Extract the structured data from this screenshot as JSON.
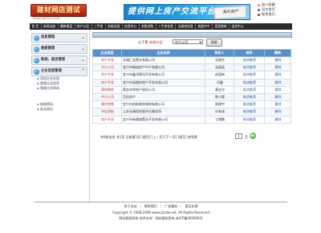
{
  "header": {
    "logo_text": "建材网店测试",
    "logo_url": "www.jiancai.com",
    "banner_text": "提供网上房产交流平台",
    "banner_sign": "海外房产",
    "top_links": [
      "加入收藏",
      "设为首页",
      "联系我们"
    ]
  },
  "nav": {
    "items": [
      "首 页",
      "新闻动态",
      "最新楼盘",
      "房产公告",
      "二手房",
      "房屋出租",
      "信息中心",
      "求租求购",
      "二手房信息",
      "出租房信息",
      "房屋中介",
      "家居装修",
      "会员中心"
    ]
  },
  "sidebar": {
    "blocks": [
      {
        "label": "信息管理"
      },
      {
        "label": "楼盘管理"
      },
      {
        "label": "新闻、留言管理"
      },
      {
        "label": "企业信息管理"
      }
    ],
    "sub_items": [
      "添加企业信息",
      "管理企业信息",
      "管理企业网站"
    ],
    "bottom_items": [
      "修改密码",
      "安全退出"
    ]
  },
  "search": {
    "label_prefix": "以下是",
    "label_highlight": "新闻内容",
    "select_value": "中介公司",
    "button": "搜索"
  },
  "table": {
    "headers": [
      "企业类型",
      "企业名称",
      "联系人",
      "修改",
      "删除"
    ],
    "rows": [
      [
        "房产开发",
        "无锡汇宏置业有限公司",
        "吴建东",
        "取消推荐",
        "删除"
      ],
      [
        "中介公司",
        "宜兴市精诚房产中介有限公司",
        "吴超英",
        "取消推荐",
        "删除"
      ],
      [
        "房产开发",
        "宜兴市鑫鸿建设开发有限公司",
        "赵国新",
        "取消推荐",
        "删除"
      ],
      [
        "房产开发",
        "宜兴市溪雅房地产开发有限公司",
        "冯健",
        "取消推荐",
        "删除"
      ],
      [
        "建材销售",
        "黄金亦房地产经纪公司",
        "黄金亦",
        "取消推荐",
        "删除"
      ],
      [
        "中介公司",
        "百信房产",
        "陈小颖",
        "取消推荐",
        "删除"
      ],
      [
        "建材销售",
        "宜兴市创新装饰装修有限公司",
        "周建中",
        "取消推荐",
        "删除"
      ],
      [
        "评估测绘",
        "江苏无锡阳房屋评估事务所",
        "孙有成",
        "取消推荐",
        "删除"
      ],
      [
        "房产开发",
        "宜兴市新顺城置业开发有限公司",
        "丁建鹏",
        "取消推荐",
        "删除"
      ]
    ]
  },
  "pager": {
    "text": "共9条信息  共1页  当前第1页  [首页] [上一页] [下一页] [尾页]  转到第",
    "page_value": "1",
    "page_suffix": "页",
    "go": "GO"
  },
  "footer": {
    "links": [
      "关于本站",
      "联系我们",
      "广告服务",
      "意见反馈"
    ],
    "copyright": "Copyright © 2008-2009 www.zzcdw.net. All Rights Reserved",
    "info": "网站版权所有 技术支持：网站版权所有 苏ICP备000000号"
  },
  "colors": {
    "nav_bg": "#2a2a2a",
    "table_header": "#5b8fc9",
    "accent_red": "#c0392b"
  }
}
